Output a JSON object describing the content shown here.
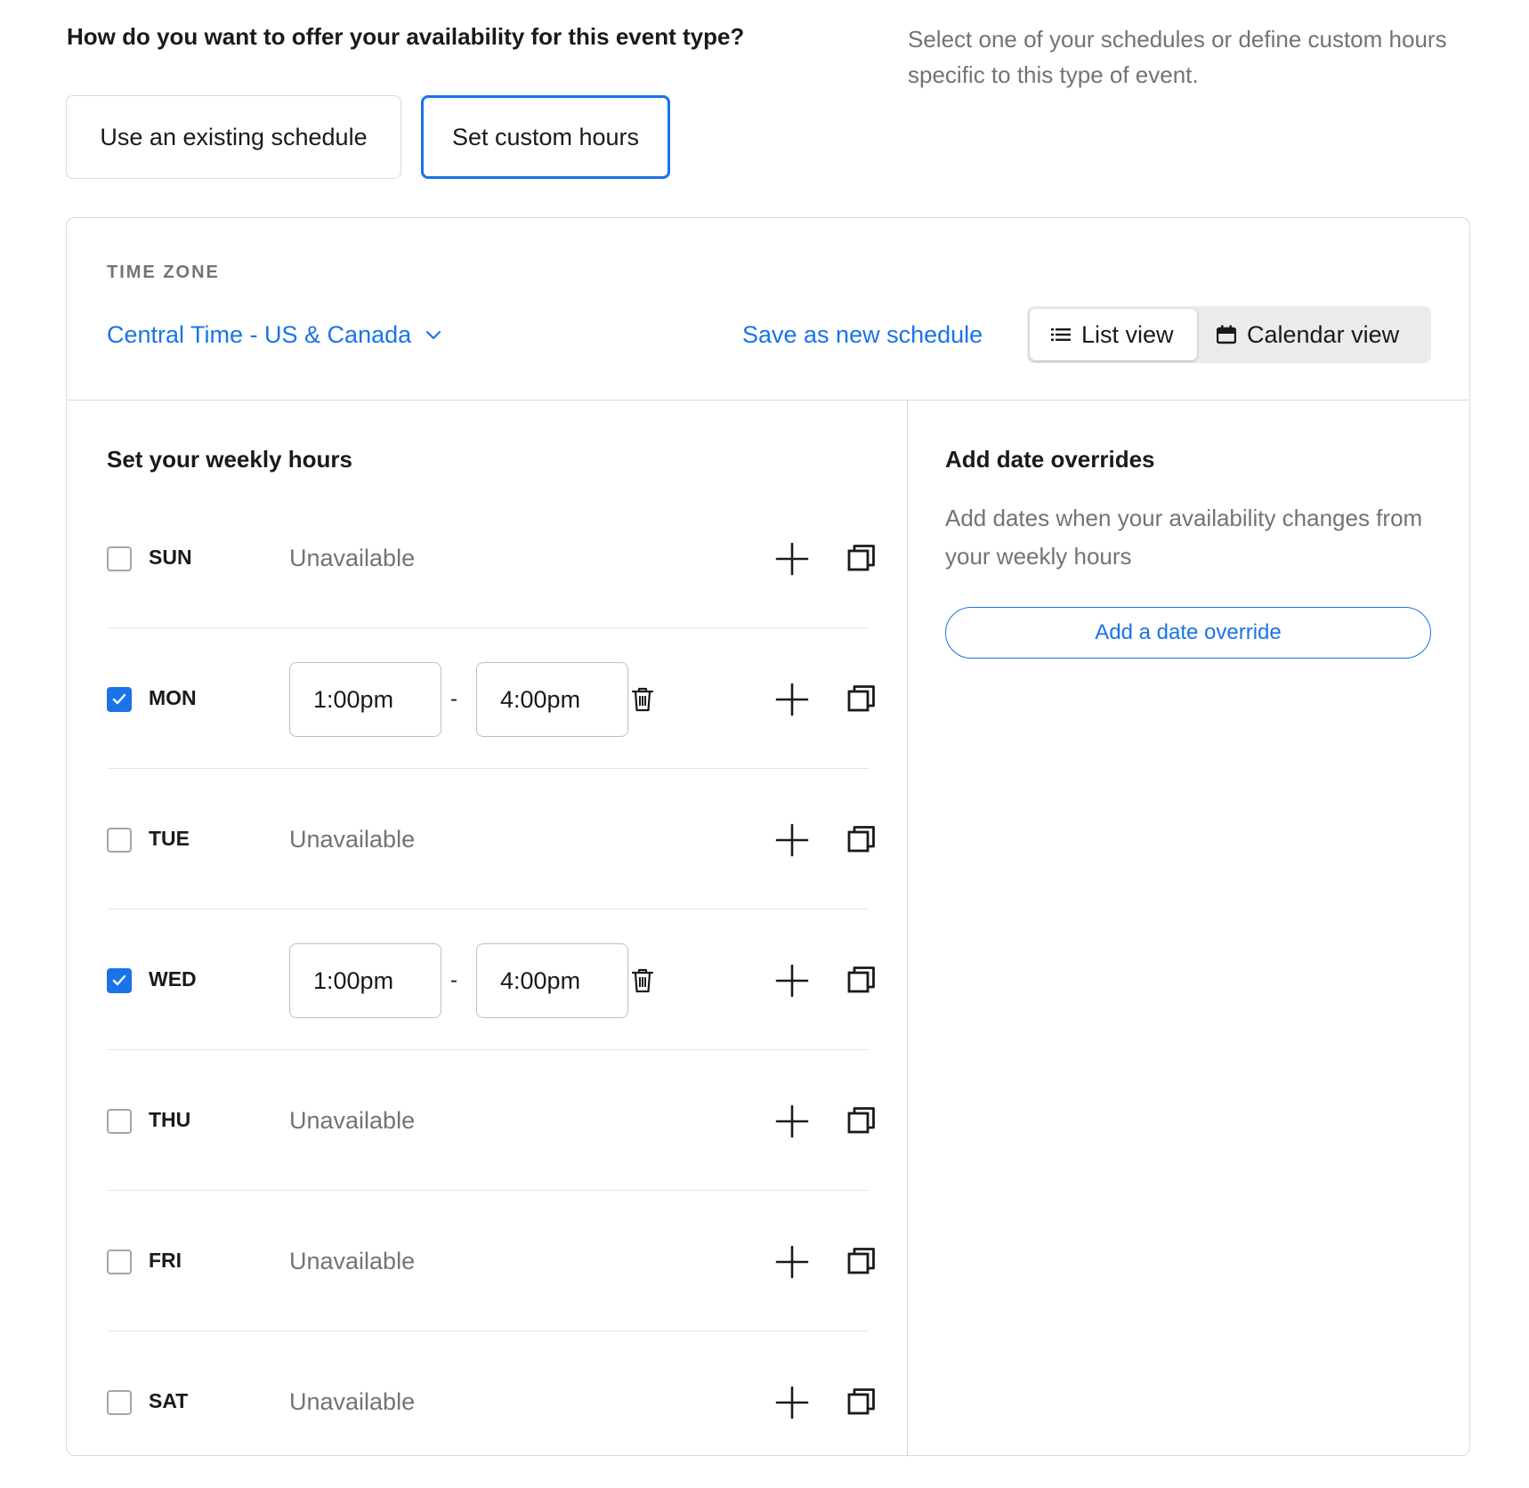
{
  "header": {
    "question": "How do you want to offer your availability for this event type?",
    "help_text": "Select one of your schedules or define custom hours specific to this type of event."
  },
  "options": {
    "existing_label": "Use an existing schedule",
    "custom_label": "Set custom hours",
    "selected": "custom"
  },
  "timezone": {
    "label": "TIME ZONE",
    "value": "Central Time - US & Canada"
  },
  "actions": {
    "save_schedule": "Save as new schedule"
  },
  "view_toggle": {
    "list_label": "List view",
    "calendar_label": "Calendar view",
    "active": "list"
  },
  "weekly": {
    "title": "Set your weekly hours",
    "unavailable_text": "Unavailable",
    "days": [
      {
        "label": "SUN",
        "checked": false
      },
      {
        "label": "MON",
        "checked": true,
        "start": "1:00pm",
        "end": "4:00pm"
      },
      {
        "label": "TUE",
        "checked": false
      },
      {
        "label": "WED",
        "checked": true,
        "start": "1:00pm",
        "end": "4:00pm"
      },
      {
        "label": "THU",
        "checked": false
      },
      {
        "label": "FRI",
        "checked": false
      },
      {
        "label": "SAT",
        "checked": false
      }
    ]
  },
  "overrides": {
    "title": "Add date overrides",
    "description": "Add dates when your availability changes from your weekly hours",
    "button_label": "Add a date override"
  },
  "colors": {
    "accent": "#1a73e8",
    "muted_text": "#737373",
    "border": "#d9d9d9"
  },
  "icons": {
    "chevron": "chevron-down-icon",
    "list": "list-icon",
    "calendar": "calendar-icon",
    "trash": "trash-icon",
    "add": "plus-icon",
    "copy": "copy-icon",
    "check": "check-icon"
  }
}
